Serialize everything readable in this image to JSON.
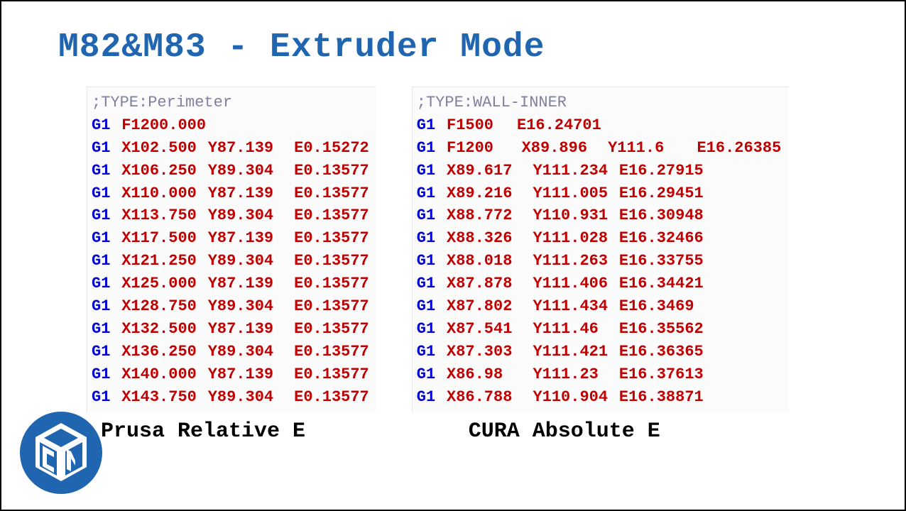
{
  "title": "M82&M83 - Extruder Mode",
  "left": {
    "caption": "Prusa Relative E",
    "comment": ";TYPE:Perimeter",
    "first": {
      "cmd": "G1",
      "f": "F1200.000"
    },
    "lines": [
      {
        "cmd": "G1",
        "x": "X102.500",
        "y": "Y87.139",
        "e": "E0.15272"
      },
      {
        "cmd": "G1",
        "x": "X106.250",
        "y": "Y89.304",
        "e": "E0.13577"
      },
      {
        "cmd": "G1",
        "x": "X110.000",
        "y": "Y87.139",
        "e": "E0.13577"
      },
      {
        "cmd": "G1",
        "x": "X113.750",
        "y": "Y89.304",
        "e": "E0.13577"
      },
      {
        "cmd": "G1",
        "x": "X117.500",
        "y": "Y87.139",
        "e": "E0.13577"
      },
      {
        "cmd": "G1",
        "x": "X121.250",
        "y": "Y89.304",
        "e": "E0.13577"
      },
      {
        "cmd": "G1",
        "x": "X125.000",
        "y": "Y87.139",
        "e": "E0.13577"
      },
      {
        "cmd": "G1",
        "x": "X128.750",
        "y": "Y89.304",
        "e": "E0.13577"
      },
      {
        "cmd": "G1",
        "x": "X132.500",
        "y": "Y87.139",
        "e": "E0.13577"
      },
      {
        "cmd": "G1",
        "x": "X136.250",
        "y": "Y89.304",
        "e": "E0.13577"
      },
      {
        "cmd": "G1",
        "x": "X140.000",
        "y": "Y87.139",
        "e": "E0.13577"
      },
      {
        "cmd": "G1",
        "x": "X143.750",
        "y": "Y89.304",
        "e": "E0.13577"
      }
    ]
  },
  "right": {
    "caption": "CURA Absolute E",
    "comment": ";TYPE:WALL-INNER",
    "first": {
      "cmd": "G1",
      "f": "F1500",
      "e": "E16.24701"
    },
    "second": {
      "cmd": "G1",
      "f": "F1200",
      "x": "X89.896",
      "y": "Y111.6",
      "e": "E16.26385"
    },
    "lines": [
      {
        "cmd": "G1",
        "x": "X89.617",
        "y": "Y111.234",
        "e": "E16.27915"
      },
      {
        "cmd": "G1",
        "x": "X89.216",
        "y": "Y111.005",
        "e": "E16.29451"
      },
      {
        "cmd": "G1",
        "x": "X88.772",
        "y": "Y110.931",
        "e": "E16.30948"
      },
      {
        "cmd": "G1",
        "x": "X88.326",
        "y": "Y111.028",
        "e": "E16.32466"
      },
      {
        "cmd": "G1",
        "x": "X88.018",
        "y": "Y111.263",
        "e": "E16.33755"
      },
      {
        "cmd": "G1",
        "x": "X87.878",
        "y": "Y111.406",
        "e": "E16.34421"
      },
      {
        "cmd": "G1",
        "x": "X87.802",
        "y": "Y111.434",
        "e": "E16.3469"
      },
      {
        "cmd": "G1",
        "x": "X87.541",
        "y": "Y111.46",
        "e": "E16.35562"
      },
      {
        "cmd": "G1",
        "x": "X87.303",
        "y": "Y111.421",
        "e": "E16.36365"
      },
      {
        "cmd": "G1",
        "x": "X86.98",
        "y": "Y111.23",
        "e": "E16.37613"
      },
      {
        "cmd": "G1",
        "x": "X86.788",
        "y": "Y110.904",
        "e": "E16.38871"
      }
    ]
  }
}
